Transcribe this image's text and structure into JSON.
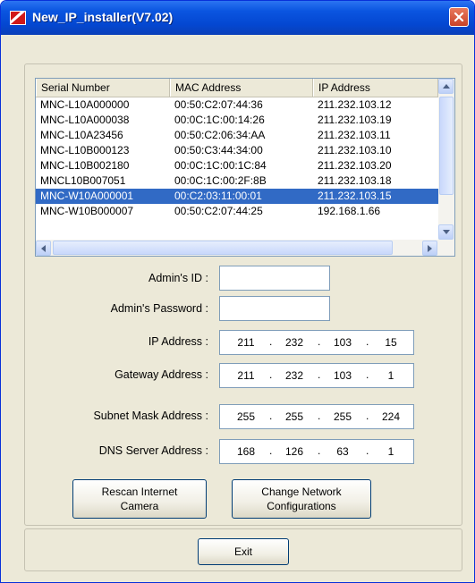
{
  "window": {
    "title": "New_IP_installer(V7.02)"
  },
  "listview": {
    "columns": [
      "Serial Number",
      "MAC Address",
      "IP Address"
    ],
    "rows": [
      [
        "MNC-L10A000000",
        "00:50:C2:07:44:36",
        "211.232.103.12"
      ],
      [
        "MNC-L10A000038",
        "00:0C:1C:00:14:26",
        "211.232.103.19"
      ],
      [
        "MNC-L10A23456",
        "00:50:C2:06:34:AA",
        "211.232.103.11"
      ],
      [
        "MNC-L10B000123",
        "00:50:C3:44:34:00",
        "211.232.103.10"
      ],
      [
        "MNC-L10B002180",
        "00:0C:1C:00:1C:84",
        "211.232.103.20"
      ],
      [
        "MNCL10B007051",
        "00:0C:1C:00:2F:8B",
        "211.232.103.18"
      ],
      [
        "MNC-W10A000001",
        "00:C2:03:11:00:01",
        "211.232.103.15"
      ],
      [
        "MNC-W10B000007",
        "00:50:C2:07:44:25",
        "192.168.1.66"
      ]
    ],
    "selected_index": 6
  },
  "form": {
    "admin_id_label": "Admin's ID :",
    "admin_id_value": "",
    "admin_password_label": "Admin's Password :",
    "admin_password_value": "",
    "ip_label": "IP Address :",
    "ip": [
      "211",
      "232",
      "103",
      "15"
    ],
    "gateway_label": "Gateway Address :",
    "gateway": [
      "211",
      "232",
      "103",
      "1"
    ],
    "subnet_label": "Subnet Mask Address :",
    "subnet": [
      "255",
      "255",
      "255",
      "224"
    ],
    "dns_label": "DNS Server Address :",
    "dns": [
      "168",
      "126",
      "63",
      "1"
    ]
  },
  "buttons": {
    "rescan_line1": "Rescan Internet",
    "rescan_line2": "Camera",
    "change_line1": "Change Network",
    "change_line2": "Configurations",
    "exit": "Exit"
  },
  "icons": {
    "app": "app-logo-icon",
    "close": "close-icon",
    "scroll_up": "arrow-up-icon",
    "scroll_down": "arrow-down-icon",
    "scroll_left": "arrow-left-icon",
    "scroll_right": "arrow-right-icon"
  },
  "colors": {
    "titlebar": "#0447d1",
    "selection": "#316ac5",
    "window_bg": "#ece9d8"
  }
}
